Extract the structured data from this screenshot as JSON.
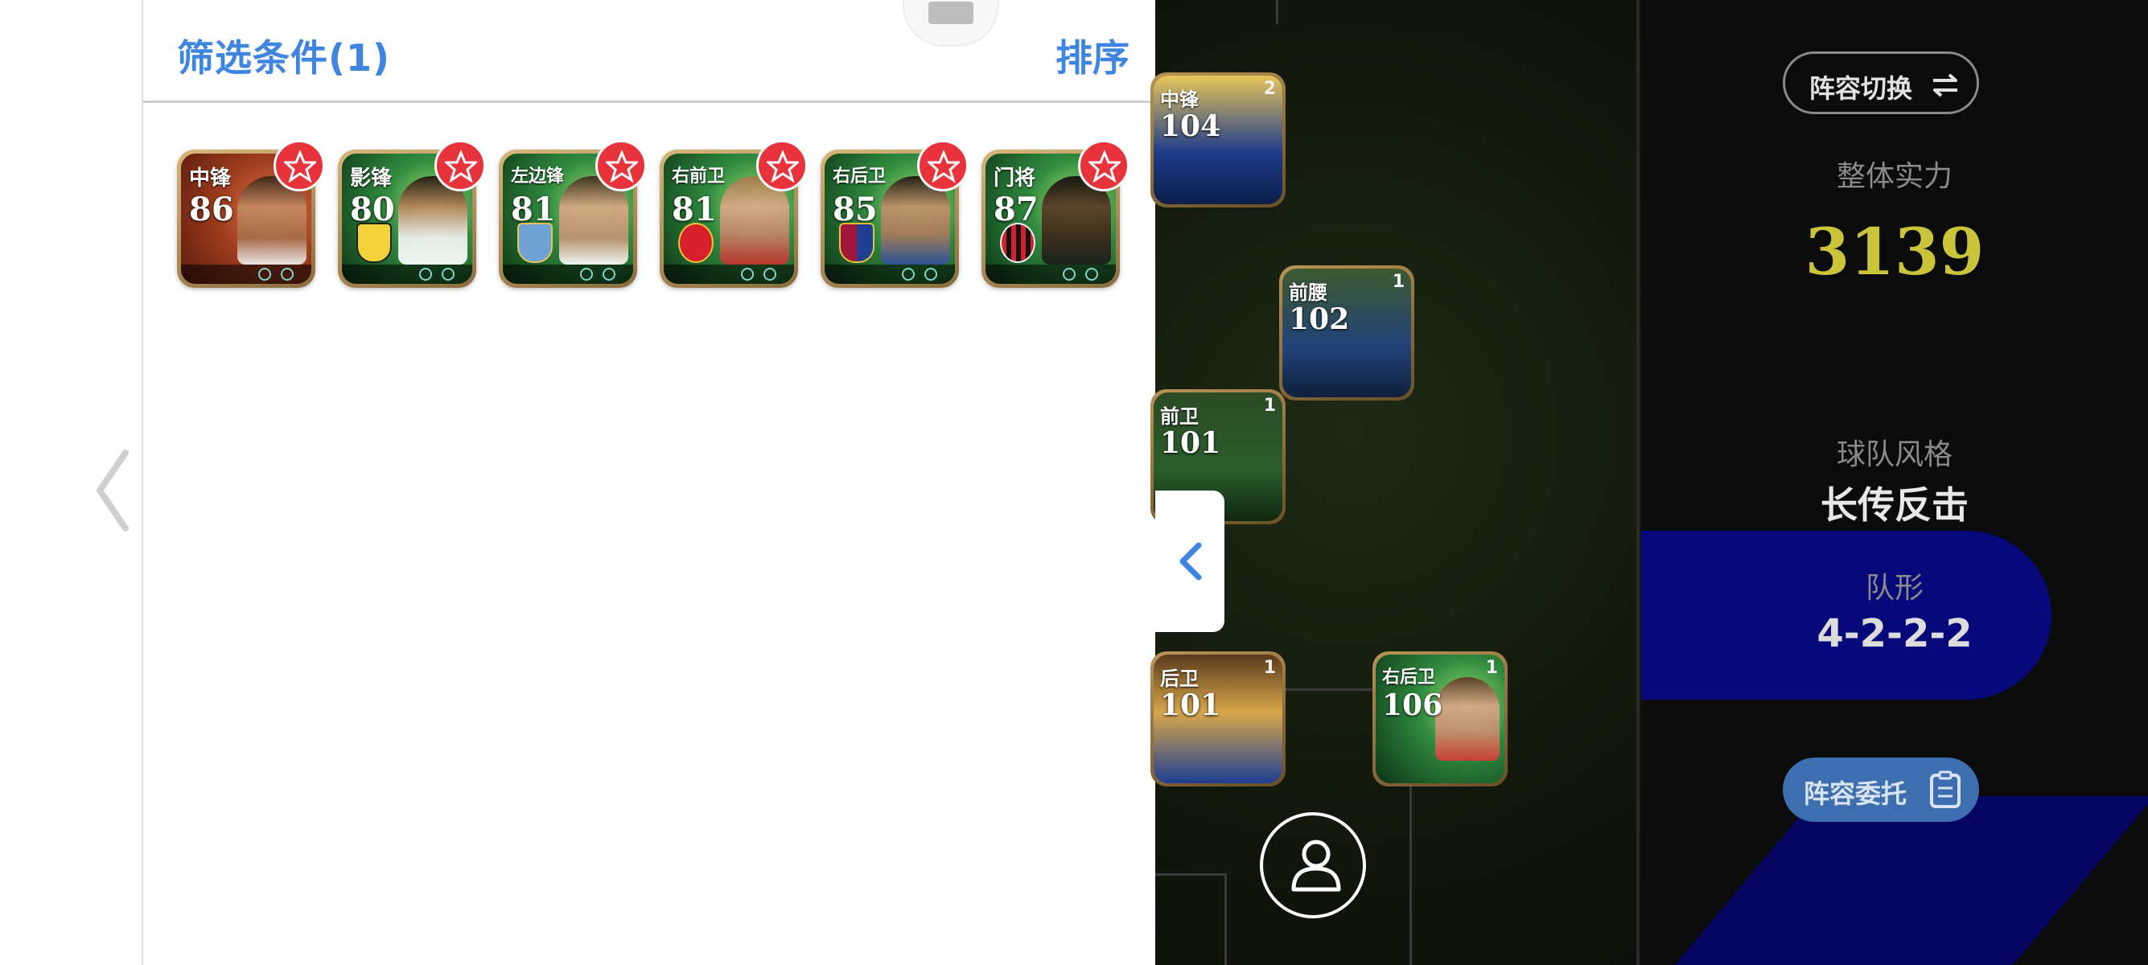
{
  "filter_panel": {
    "title": "筛选条件(1)",
    "sort_label": "排序",
    "cards": [
      {
        "position": "中锋",
        "rating": "86",
        "theme": "red"
      },
      {
        "position": "影锋",
        "rating": "80",
        "theme": "green"
      },
      {
        "position": "左边锋",
        "rating": "81",
        "theme": "green"
      },
      {
        "position": "右前卫",
        "rating": "81",
        "theme": "green"
      },
      {
        "position": "右后卫",
        "rating": "85",
        "theme": "green"
      },
      {
        "position": "门将",
        "rating": "87",
        "theme": "green"
      }
    ]
  },
  "pitch": {
    "players": [
      {
        "position": "中锋",
        "rating": "104",
        "count": "2"
      },
      {
        "position": "前腰",
        "rating": "102",
        "count": "1"
      },
      {
        "position": "前卫",
        "rating": "101",
        "count": "1"
      },
      {
        "position": "后卫",
        "rating": "101",
        "count": "1"
      },
      {
        "position": "右后卫",
        "rating": "106",
        "count": "1"
      }
    ]
  },
  "info": {
    "lineup_switch_label": "阵容切换",
    "overall_label": "整体实力",
    "overall_value": "3139",
    "style_label": "球队风格",
    "style_value": "长传反击",
    "formation_label": "队形",
    "formation_value": "4-2-2-2",
    "delegate_label": "阵容委托"
  },
  "colors": {
    "accent_blue": "#3d85e0",
    "badge_red": "#e8323c",
    "overall_gold": "#c9c43a",
    "band_blue": "#07087a"
  },
  "icons": [
    "chevron-left-icon",
    "star-badge-icon",
    "swap-arrows-icon",
    "person-icon",
    "clipboard-icon"
  ]
}
